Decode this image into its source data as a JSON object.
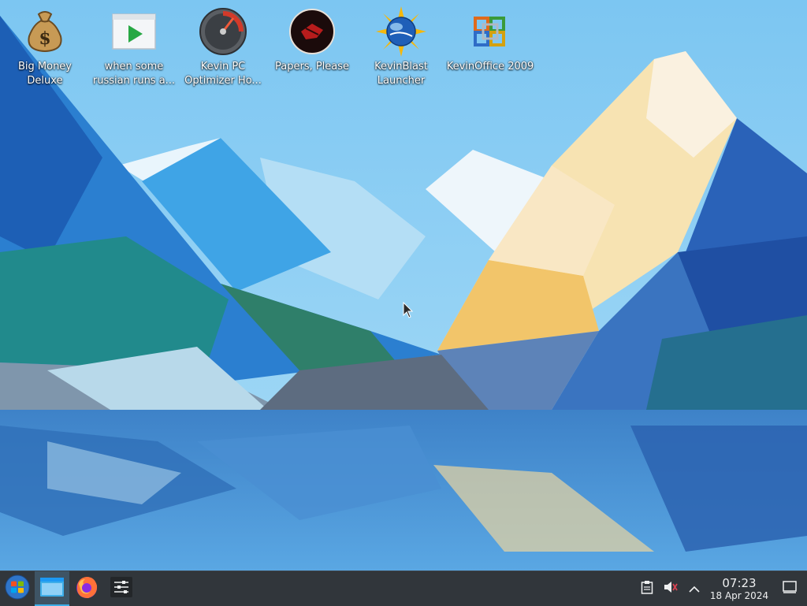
{
  "desktop": {
    "icons": [
      {
        "label": "Big Money Deluxe",
        "icon": "money-bag-icon"
      },
      {
        "label": "when some russian runs a...",
        "icon": "video-player-icon"
      },
      {
        "label": "Kevin PC Optimizer Ho...",
        "icon": "speedometer-icon"
      },
      {
        "label": "Papers, Please",
        "icon": "papers-please-icon"
      },
      {
        "label": "KevinBlast Launcher",
        "icon": "globe-sun-icon"
      },
      {
        "label": "KevinOffice 2009",
        "icon": "office-logo-icon"
      }
    ]
  },
  "taskbar": {
    "start_icon": "start-menu-icon",
    "apps": [
      {
        "name": "file-manager",
        "icon": "folder-window-icon",
        "active": true
      },
      {
        "name": "firefox",
        "icon": "firefox-icon",
        "active": false
      },
      {
        "name": "system-settings",
        "icon": "settings-sliders-icon",
        "active": false
      }
    ],
    "tray": {
      "items": [
        "clipboard-icon",
        "volume-muted-icon",
        "chevron-up-icon"
      ]
    },
    "clock": {
      "time": "07:23",
      "date": "18 Apr 2024"
    },
    "show_desktop_icon": "show-desktop-icon"
  },
  "colors": {
    "taskbar_bg": "#31363b",
    "accent": "#3daee9",
    "text_light": "#eff0f1"
  }
}
